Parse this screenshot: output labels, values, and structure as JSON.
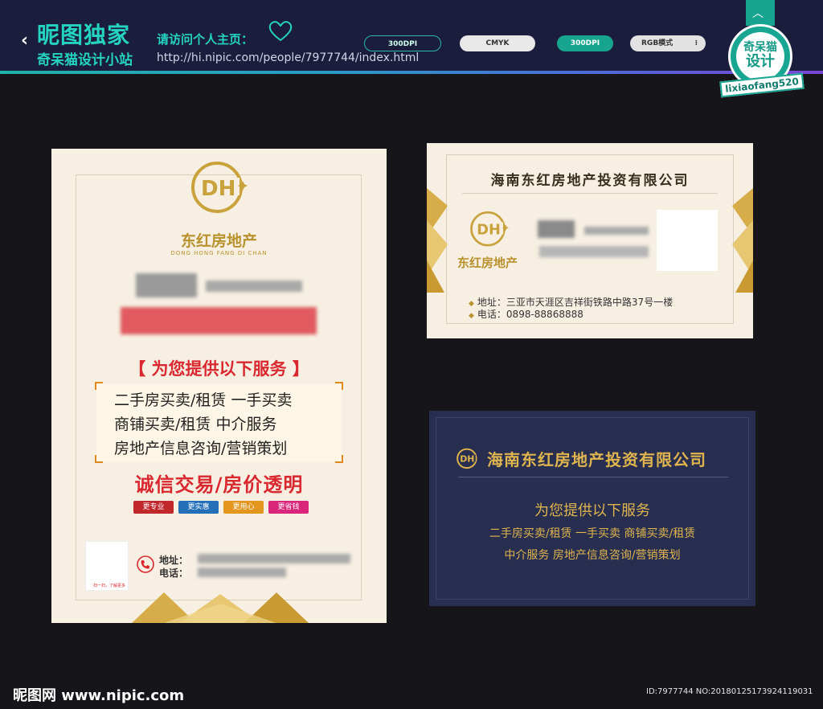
{
  "header": {
    "back_glyph": "‹",
    "brand_title": "昵图独家",
    "brand_sub": "奇呆猫设计小站",
    "visit_label": "请访问个人主页：",
    "visit_url": "http://hi.nipic.com/people/7977744/index.html",
    "pills": [
      "300DPI",
      "CMYK",
      "300DPI",
      "RGB模式"
    ],
    "badge_text_1": "奇呆猫",
    "badge_text_2": "设计",
    "badge_user": "lixiaofang520",
    "accent_color": "#24d4c0"
  },
  "flyer": {
    "company_cn": "东红房地产",
    "company_pinyin": "DONG HONG FANG DI CHAN",
    "service_title": "【 为您提供以下服务 】",
    "service_lines": [
      "二手房买卖/租赁    一手买卖",
      "商铺买卖/租赁    中介服务",
      "房地产信息咨询/营销策划"
    ],
    "slogan": "诚信交易/房价透明",
    "tags": [
      "更专业",
      "更实惠",
      "更用心",
      "更省钱"
    ],
    "tag_colors": [
      "#c0282c",
      "#2370b8",
      "#e2961e",
      "#d9257a"
    ],
    "qr_caption": "扫一扫，了解更多",
    "addr_label": "地址：",
    "tel_label": "电话："
  },
  "card_cream": {
    "title": "海南东红房地产投资有限公司",
    "company_cn": "东红房地产",
    "addr": "地址：三亚市天涯区吉祥街铁路中路37号一楼",
    "tel": "电话：0898-88868888"
  },
  "card_dark": {
    "title": "海南东红房地产投资有限公司",
    "service_title": "为您提供以下服务",
    "line1": "二手房买卖/租赁  一手买卖  商铺买卖/租赁",
    "line2": "中介服务  房地产信息咨询/营销策划"
  },
  "footer": {
    "logo": "昵图网 www.nipic.com",
    "id": "ID:7977744 NO:20180125173924119031"
  }
}
